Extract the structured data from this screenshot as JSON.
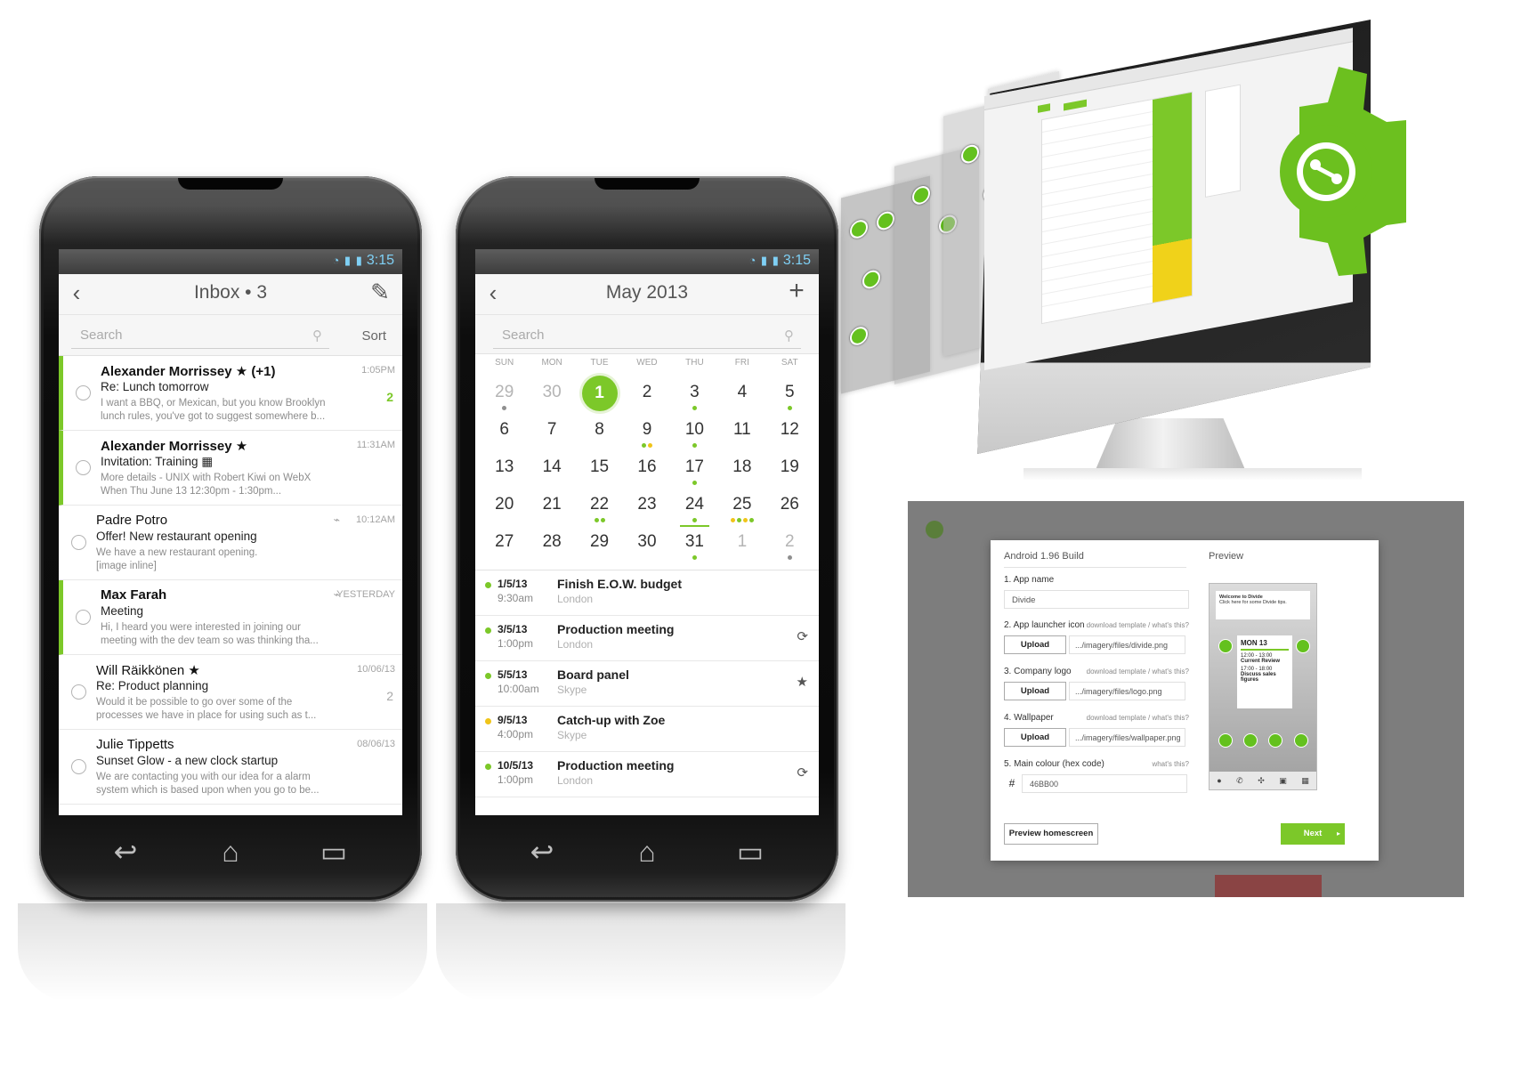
{
  "colors": {
    "accent": "#7cc829",
    "yellow": "#f0c419",
    "status_blue": "#7fd0f5"
  },
  "status": {
    "time": "3:15"
  },
  "inbox": {
    "title": "Inbox • 3",
    "search_placeholder": "Search",
    "sort_label": "Sort",
    "messages": [
      {
        "from": "Alexander Morrissey ★ (+1)",
        "subject": "Re: Lunch tomorrow",
        "preview1": "I want a BBQ, or Mexican, but you know Brooklyn",
        "preview2": "lunch rules, you've got to suggest somewhere b...",
        "time": "1:05PM",
        "count": "2",
        "unread": true
      },
      {
        "from": "Alexander Morrissey ★",
        "subject": "Invitation: Training ▦",
        "preview1": "More details - UNIX with Robert Kiwi on WebX",
        "preview2": "When Thu June 13 12:30pm - 1:30pm...",
        "time": "11:31AM",
        "count": "",
        "unread": true
      },
      {
        "from": "Padre Potro",
        "subject": "Offer! New restaurant opening",
        "preview1": "We have a new restaurant opening.",
        "preview2": "[image inline]",
        "time": "10:12AM",
        "count": "",
        "unread": false
      },
      {
        "from": "Max Farah",
        "subject": "Meeting",
        "preview1": "Hi, I heard you were interested in joining our",
        "preview2": "meeting with the dev team so was thinking tha...",
        "time": "YESTERDAY",
        "count": "",
        "unread": true
      },
      {
        "from": "Will Räikkönen ★",
        "subject": "Re: Product planning",
        "preview1": "Would it be possible to go over some of the",
        "preview2": "processes we have in place for using such as t...",
        "time": "10/06/13",
        "count": "2",
        "unread": false
      },
      {
        "from": "Julie Tippetts",
        "subject": "Sunset Glow - a new clock startup",
        "preview1": "We are contacting you with our idea for a alarm",
        "preview2": "system which is based upon when you go to be...",
        "time": "08/06/13",
        "count": "",
        "unread": false
      }
    ]
  },
  "calendar": {
    "title": "May 2013",
    "search_placeholder": "Search",
    "weekdays": [
      "SUN",
      "MON",
      "TUE",
      "WED",
      "THU",
      "FRI",
      "SAT"
    ],
    "days": [
      {
        "n": "29",
        "m": true,
        "dots": "g"
      },
      {
        "n": "30",
        "m": true
      },
      {
        "n": "1",
        "today": true
      },
      {
        "n": "2"
      },
      {
        "n": "3",
        "dots": "a"
      },
      {
        "n": "4"
      },
      {
        "n": "5",
        "dots": "a"
      },
      {
        "n": "6"
      },
      {
        "n": "7"
      },
      {
        "n": "8"
      },
      {
        "n": "9",
        "dots": "ay"
      },
      {
        "n": "10",
        "dots": "a"
      },
      {
        "n": "11"
      },
      {
        "n": "12"
      },
      {
        "n": "13"
      },
      {
        "n": "14"
      },
      {
        "n": "15"
      },
      {
        "n": "16"
      },
      {
        "n": "17",
        "dots": "a"
      },
      {
        "n": "18"
      },
      {
        "n": "19"
      },
      {
        "n": "20"
      },
      {
        "n": "21"
      },
      {
        "n": "22",
        "dots": "aa"
      },
      {
        "n": "23"
      },
      {
        "n": "24",
        "dots": "a",
        "ul": true
      },
      {
        "n": "25",
        "dots": "yaya"
      },
      {
        "n": "26"
      },
      {
        "n": "27"
      },
      {
        "n": "28"
      },
      {
        "n": "29"
      },
      {
        "n": "30"
      },
      {
        "n": "31",
        "dots": "a"
      },
      {
        "n": "1",
        "m": true
      },
      {
        "n": "2",
        "m": true,
        "dots": "g"
      }
    ],
    "events": [
      {
        "date": "1/5/13",
        "time": "9:30am",
        "name": "Finish E.O.W. budget",
        "location": "London",
        "color": "a",
        "icon": ""
      },
      {
        "date": "3/5/13",
        "time": "1:00pm",
        "name": "Production meeting",
        "location": "London",
        "color": "a",
        "icon": "⟳"
      },
      {
        "date": "5/5/13",
        "time": "10:00am",
        "name": "Board panel",
        "location": "Skype",
        "color": "a",
        "icon": "★"
      },
      {
        "date": "9/5/13",
        "time": "4:00pm",
        "name": "Catch-up with Zoe",
        "location": "Skype",
        "color": "y",
        "icon": ""
      },
      {
        "date": "10/5/13",
        "time": "1:00pm",
        "name": "Production meeting",
        "location": "London",
        "color": "a",
        "icon": "⟳"
      }
    ]
  },
  "builder": {
    "dialog_title": "Android 1.96 Build",
    "preview_title": "Preview",
    "fields": {
      "app_name_label": "1. App name",
      "app_name_value": "Divide",
      "launcher_label": "2. App launcher icon",
      "launcher_help": "download template / what's this?",
      "launcher_path": ".../imagery/files/divide.png",
      "logo_label": "3. Company logo",
      "logo_help": "download template / what's this?",
      "logo_path": ".../imagery/files/logo.png",
      "wallpaper_label": "4. Wallpaper",
      "wallpaper_help": "download template / what's this?",
      "wallpaper_path": ".../imagery/files/wallpaper.png",
      "colour_label": "5. Main colour (hex code)",
      "colour_help": "what's this?",
      "colour_hash": "#",
      "colour_value": "46BB00"
    },
    "upload_label": "Upload",
    "preview_button": "Preview homescreen",
    "next_button": "Next",
    "preview_screen": {
      "tip_title": "Welcome to Divide",
      "tip_body": "Click here for some Divide tips.",
      "widget_date": "MON 13",
      "widget_time1": "12:00 - 13:00",
      "widget_ev1": "Current Review",
      "widget_time2": "17:00 - 18:00",
      "widget_ev2": "Discuss sales figures"
    }
  }
}
